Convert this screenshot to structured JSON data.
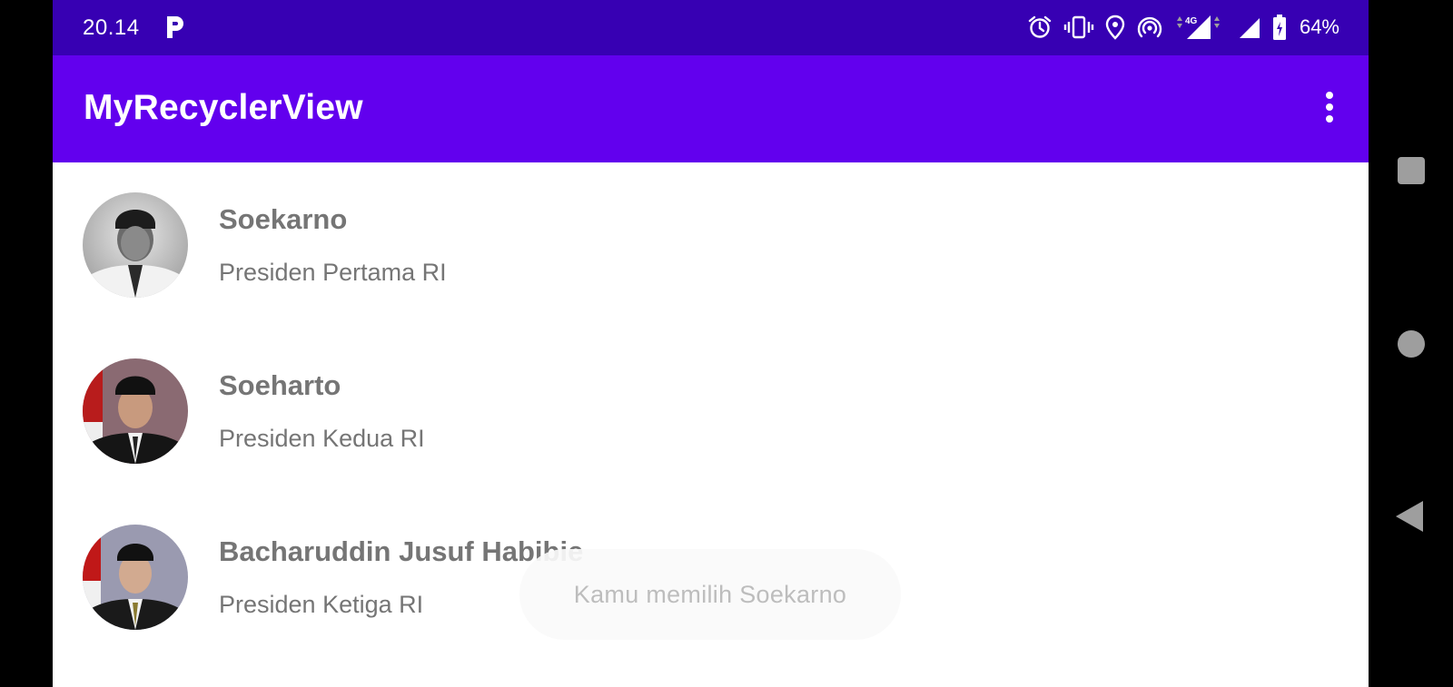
{
  "status_bar": {
    "time": "20.14",
    "battery_text": "64%",
    "network_label": "4G",
    "icons": [
      "p-app-icon",
      "alarm-icon",
      "vibrate-icon",
      "location-icon",
      "hotspot-icon",
      "mobile-signal-icon",
      "wifi-signal-icon",
      "battery-icon"
    ]
  },
  "app_bar": {
    "title": "MyRecyclerView",
    "menu_icon": "overflow-menu-icon"
  },
  "list": {
    "items": [
      {
        "name": "Soekarno",
        "description": "Presiden Pertama RI"
      },
      {
        "name": "Soeharto",
        "description": "Presiden Kedua RI"
      },
      {
        "name": "Bacharuddin Jusuf Habibie",
        "description": "Presiden Ketiga RI"
      }
    ]
  },
  "toast": {
    "message": "Kamu memilih Soekarno"
  },
  "navigation": {
    "buttons": [
      "recents-icon",
      "home-icon",
      "back-icon"
    ]
  },
  "colors": {
    "status_bar": "#3700b3",
    "app_bar": "#6200ee",
    "text_primary": "#757575"
  }
}
